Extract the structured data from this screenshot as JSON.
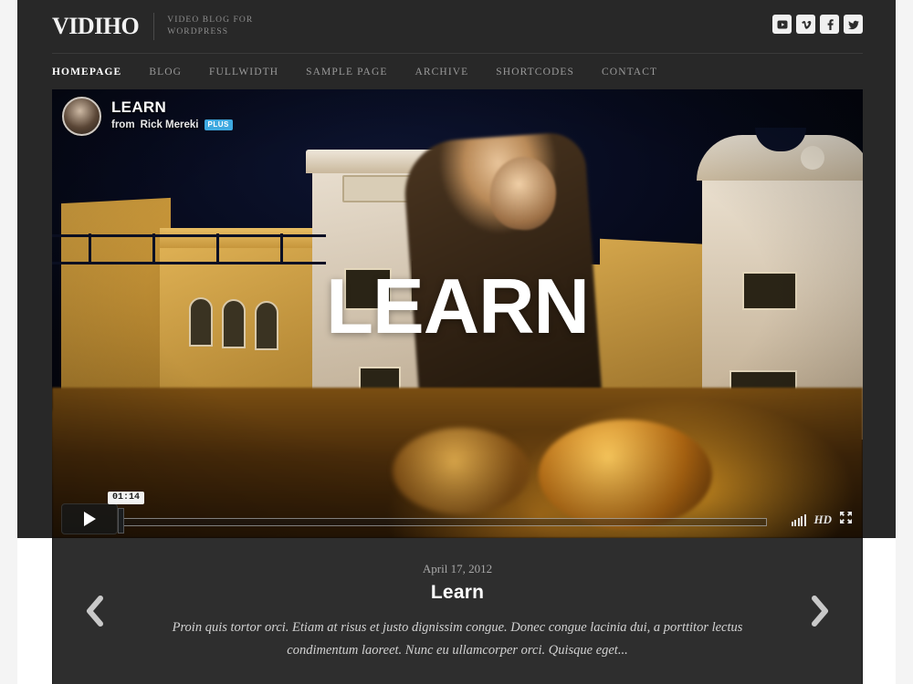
{
  "brand": {
    "name": "VIDIHO",
    "tagline_line1": "VIDEO BLOG FOR",
    "tagline_line2": "WORDPRESS"
  },
  "social": [
    {
      "name": "youtube",
      "label": "YouTube"
    },
    {
      "name": "vimeo",
      "label": "Vimeo"
    },
    {
      "name": "facebook",
      "label": "Facebook"
    },
    {
      "name": "twitter",
      "label": "Twitter"
    }
  ],
  "nav": {
    "items": [
      {
        "label": "HOMEPAGE",
        "active": true
      },
      {
        "label": "BLOG",
        "active": false
      },
      {
        "label": "FULLWIDTH",
        "active": false
      },
      {
        "label": "SAMPLE PAGE",
        "active": false
      },
      {
        "label": "ARCHIVE",
        "active": false
      },
      {
        "label": "SHORTCODES",
        "active": false
      },
      {
        "label": "CONTACT",
        "active": false
      }
    ]
  },
  "video": {
    "title": "LEARN",
    "author_prefix": "from",
    "author": "Rick Mereki",
    "badge": "PLUS",
    "overlay_title": "LEARN",
    "controls": {
      "play_label": "Play",
      "current_time": "01:14",
      "hd_label": "HD",
      "volume_label": "Volume",
      "fullscreen_label": "Fullscreen"
    }
  },
  "caption": {
    "date": "April 17, 2012",
    "title": "Learn",
    "excerpt": "Proin quis tortor orci. Etiam at risus et justo dignissim congue. Donec congue lacinia dui, a porttitor lectus condimentum laoreet. Nunc eu ullamcorper orci. Quisque eget...",
    "prev_label": "Previous",
    "next_label": "Next"
  },
  "colors": {
    "header_bg": "#282828",
    "caption_bg": "#2e2e2e",
    "accent_blue": "#3ea9e0",
    "page_bg": "#ffffff",
    "nav_active": "#ffffff",
    "nav_inactive": "#9a9a9a"
  }
}
